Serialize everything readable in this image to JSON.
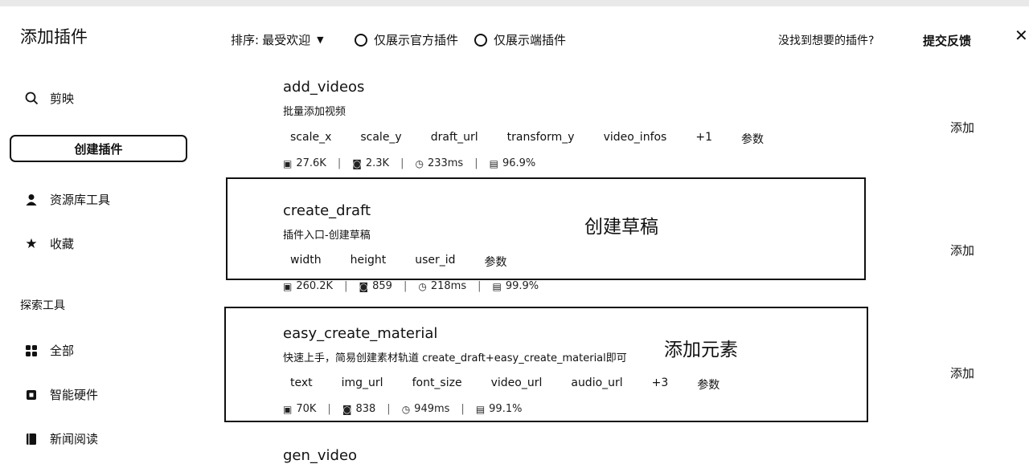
{
  "header": {
    "title": "添加插件",
    "sort_label": "排序:",
    "sort_value": "最受欢迎",
    "filter_official": "仅展示官方插件",
    "filter_endpoint": "仅展示端插件",
    "not_found": "没找到想要的插件?",
    "feedback": "提交反馈",
    "close": "✕"
  },
  "sidebar": {
    "search_label": "剪映",
    "create_button": "创建插件",
    "resource_tools": "资源库工具",
    "favorites": "收藏",
    "explore_label": "探索工具",
    "explore_items": [
      "全部",
      "智能硬件",
      "新闻阅读"
    ]
  },
  "plugins": [
    {
      "name": "add_videos",
      "desc": "批量添加视频",
      "params": [
        "scale_x",
        "scale_y",
        "draft_url",
        "transform_y",
        "video_infos",
        "+1",
        "参数"
      ],
      "stats": [
        "27.6K",
        "2.3K",
        "233ms",
        "96.9%"
      ],
      "add": "添加"
    },
    {
      "name": "create_draft",
      "desc": "插件入口-创建草稿",
      "params": [
        "width",
        "height",
        "user_id",
        "参数"
      ],
      "stats": [
        "260.2K",
        "859",
        "218ms",
        "99.9%"
      ],
      "add": "添加",
      "annotation": "创建草稿"
    },
    {
      "name": "easy_create_material",
      "desc": "快速上手，简易创建素材轨道 create_draft+easy_create_material即可",
      "params": [
        "text",
        "img_url",
        "font_size",
        "video_url",
        "audio_url",
        "+3",
        "参数"
      ],
      "stats": [
        "70K",
        "838",
        "949ms",
        "99.1%"
      ],
      "add": "添加",
      "annotation": "添加元素"
    },
    {
      "name": "gen_video"
    }
  ]
}
